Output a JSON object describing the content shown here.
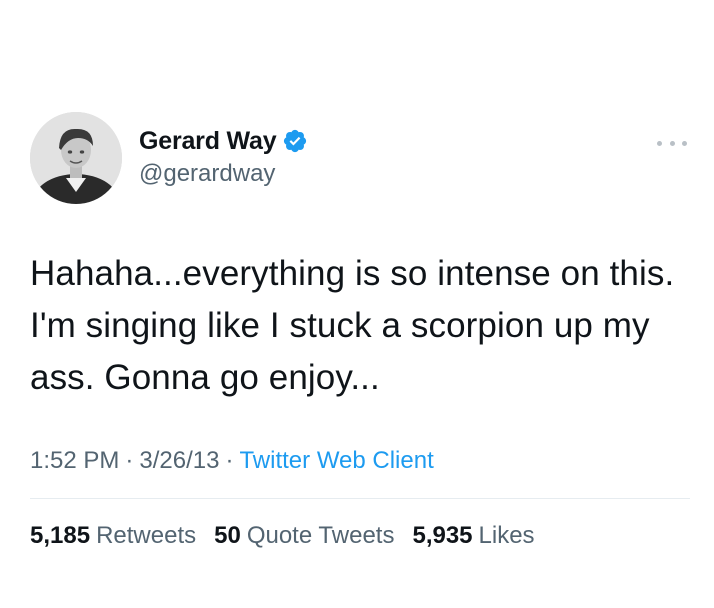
{
  "author": {
    "display_name": "Gerard Way",
    "handle": "@gerardway",
    "verified": true,
    "verified_color": "#1d9bf0"
  },
  "more_icon": "more-horizontal-icon",
  "tweet": {
    "text": "Hahaha...everything is so intense on this. I'm singing like I stuck a scorpion up my ass. Gonna go enjoy..."
  },
  "meta": {
    "time": "1:52 PM",
    "date": "3/26/13",
    "separator": "·",
    "source": "Twitter Web Client",
    "source_color": "#1d9bf0"
  },
  "stats": {
    "retweets_count": "5,185",
    "retweets_label": "Retweets",
    "quotes_count": "50",
    "quotes_label": "Quote Tweets",
    "likes_count": "5,935",
    "likes_label": "Likes"
  }
}
